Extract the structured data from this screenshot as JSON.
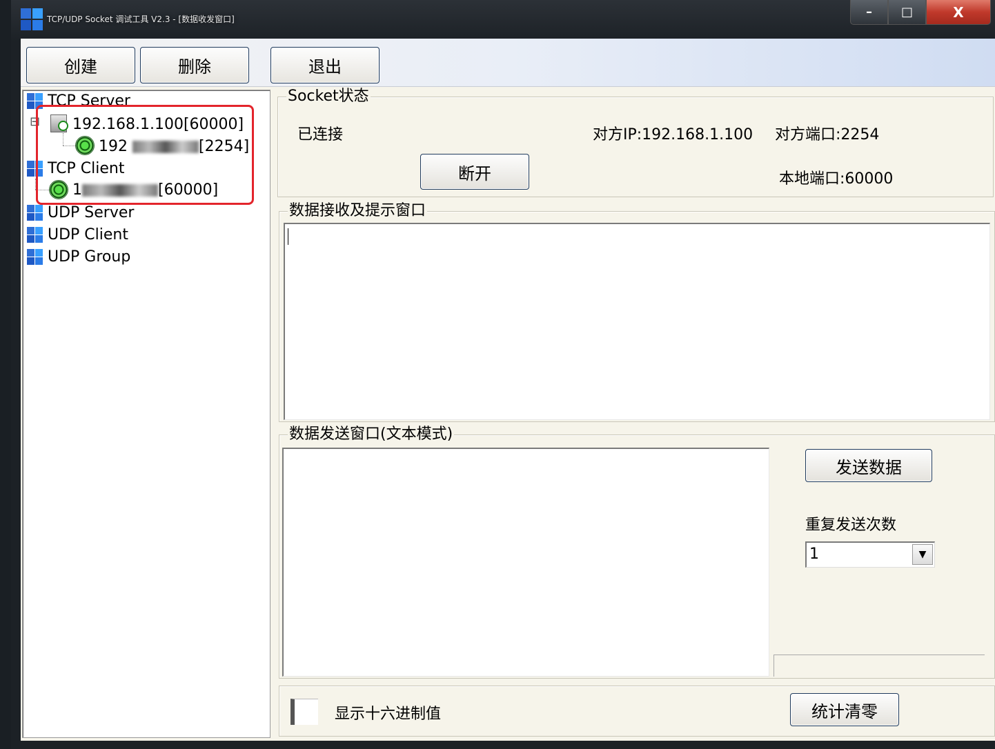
{
  "window": {
    "title": "TCP/UDP Socket 调试工具 V2.3 - [数据收发窗口]",
    "minimize": "–",
    "maximize": "□",
    "close": "X"
  },
  "toolbar": {
    "create": "创建",
    "delete": "删除",
    "exit": "退出"
  },
  "tree": {
    "tcp_server": "TCP Server",
    "server_listener": "192.168.1.100[60000]",
    "server_conn_prefix": "192",
    "server_conn_suffix": "[2254]",
    "tcp_client": "TCP Client",
    "client_conn_prefix": "1",
    "client_conn_suffix": "[60000]",
    "udp_server": "UDP Server",
    "udp_client": "UDP Client",
    "udp_group": "UDP Group",
    "collapse_glyph": "⊟"
  },
  "socket_status": {
    "title": "Socket状态",
    "state": "已连接",
    "remote_ip": "对方IP:192.168.1.100",
    "remote_port": "对方端口:2254",
    "local_port": "本地端口:60000",
    "disconnect": "断开"
  },
  "receive": {
    "title": "数据接收及提示窗口"
  },
  "send": {
    "title": "数据发送窗口(文本模式)",
    "send_button": "发送数据",
    "repeat_label": "重复发送次数",
    "repeat_value": "1",
    "arrow": "▼"
  },
  "bottom": {
    "hex_label": "显示十六进制值",
    "reset_button": "统计清零"
  },
  "colors": {
    "highlight_box": "#e3242b",
    "panel_bg": "#f6f4ea"
  }
}
